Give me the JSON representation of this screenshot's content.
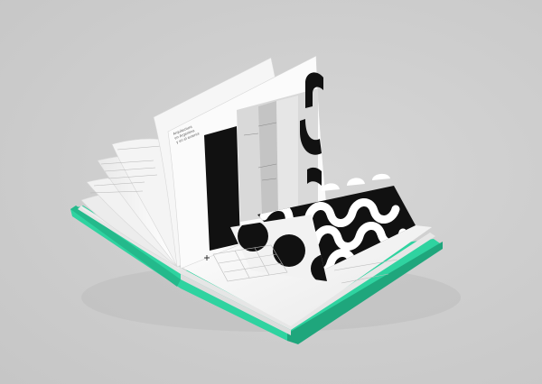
{
  "photo": {
    "subject": "open book",
    "page_text": {
      "heading_line_1": "Arquitectura",
      "heading_line_2": "en Argentina",
      "heading_line_3": "y en el exterior"
    },
    "colors": {
      "background": "#cdcdcd",
      "cover": "#2fd3a0",
      "cover_dark": "#1fa67c",
      "paper": "#f7f7f7",
      "ink": "#111111"
    }
  }
}
